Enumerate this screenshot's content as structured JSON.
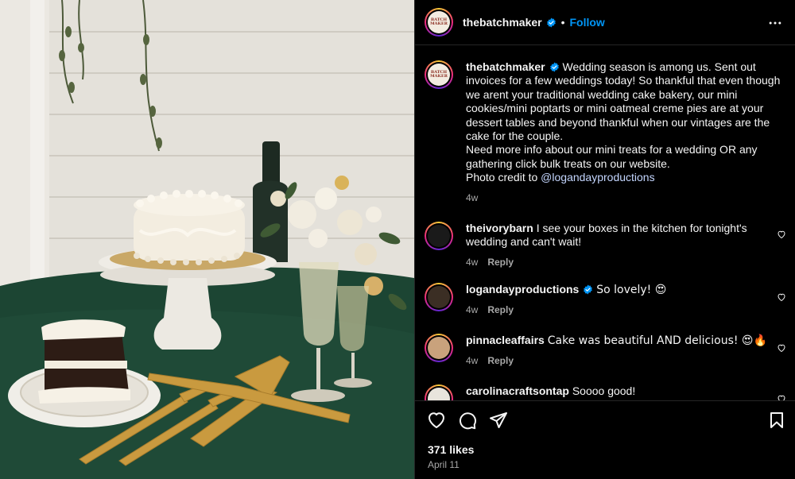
{
  "post": {
    "author": "thebatchmaker",
    "avatar_text": "BATCH MAKER",
    "follow_label": "Follow",
    "dot": "•",
    "caption_lines": [
      "Wedding season is among us. Sent out",
      "invoices for a few weddings today! So thankful that even though",
      "we arent your traditional wedding cake bakery, our mini",
      "cookies/mini poptarts or mini oatmeal creme pies are at your",
      "dessert tables and beyond thankful when our vintages are the",
      "cake for the couple.",
      "Need more info about our mini treats for a wedding OR any",
      "gathering click bulk treats on our website.",
      "Photo credit to "
    ],
    "caption_mention": "@logandayproductions",
    "caption_age": "4w"
  },
  "comments": [
    {
      "user": "theivorybarn",
      "text": "I see your boxes in the kitchen for tonight's wedding and can't wait!",
      "age": "4w",
      "reply": "Reply",
      "verified": false
    },
    {
      "user": "logandayproductions",
      "text": "So lovely! 😍",
      "age": "4w",
      "reply": "Reply",
      "verified": true
    },
    {
      "user": "pinnacleaffairs",
      "text": "Cake was beautiful AND delicious! 😍🔥",
      "age": "4w",
      "reply": "Reply",
      "verified": false
    },
    {
      "user": "carolinacraftsontap",
      "text": "Soooo good!",
      "age": "",
      "reply": "",
      "verified": false
    }
  ],
  "footer": {
    "likes": "371 likes",
    "date": "April 11"
  },
  "colors": {
    "accent": "#0095f6",
    "verified": "#0095f6",
    "tablecloth": "#1f4a37",
    "muted": "#a8a8a8"
  },
  "icons": [
    "more-icon",
    "verified-icon",
    "heart-icon",
    "comment-icon",
    "share-icon",
    "bookmark-icon"
  ]
}
